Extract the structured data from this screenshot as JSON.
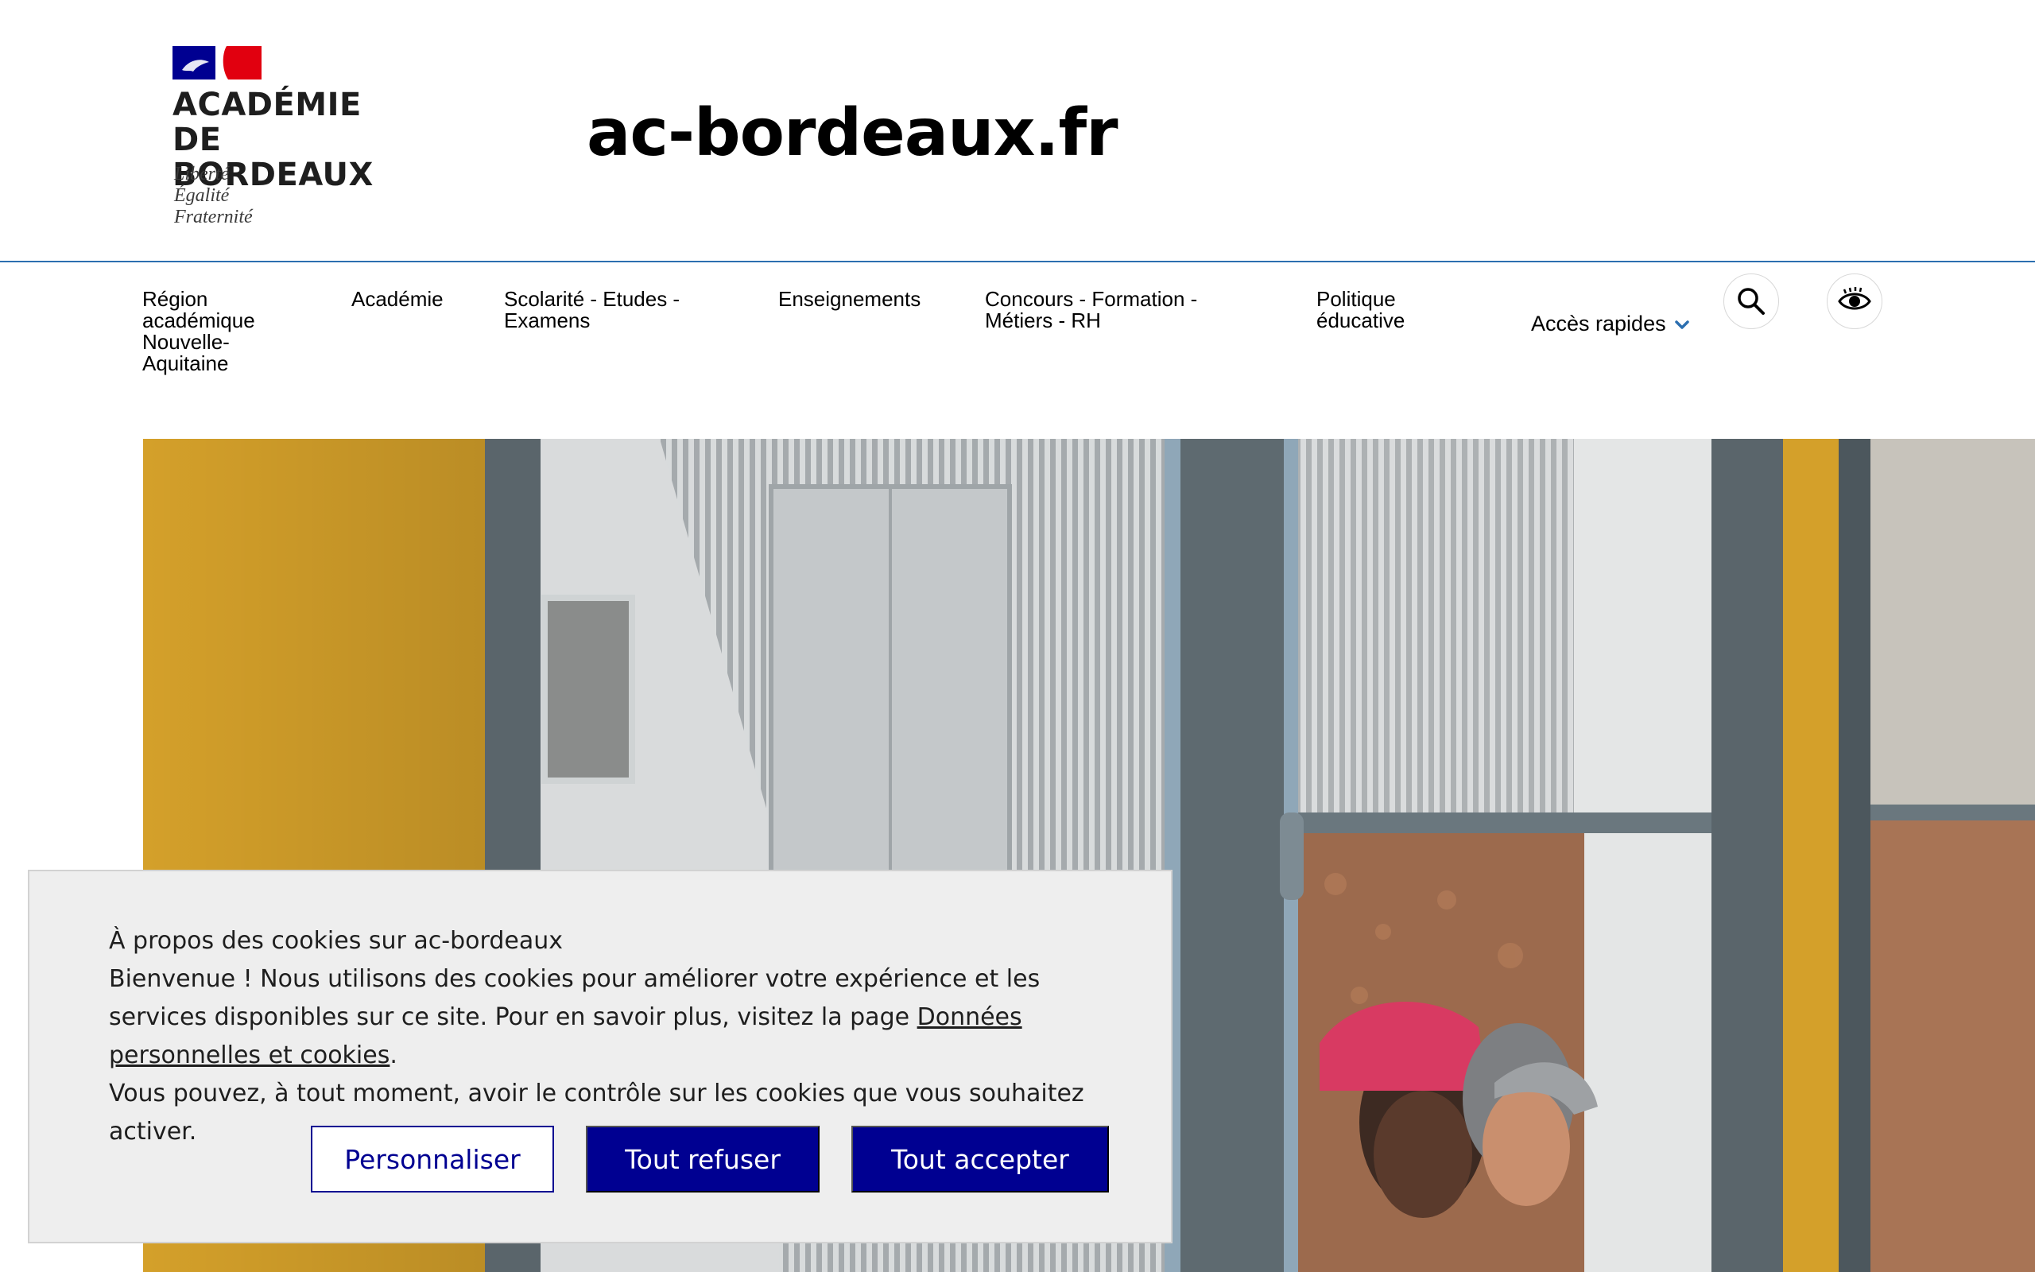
{
  "header": {
    "logo": {
      "name": "ACADÉMIE\nDE BORDEAUX",
      "motto": "Liberté\nÉgalité\nFraternité"
    },
    "site_title": "ac-bordeaux.fr"
  },
  "nav": {
    "items": [
      {
        "lines": [
          "Région",
          "académique",
          "Nouvelle-",
          "Aquitaine"
        ]
      },
      {
        "lines": [
          "Académie"
        ]
      },
      {
        "lines": [
          "Scolarité - Etudes -",
          "Examens"
        ]
      },
      {
        "lines": [
          "Enseignements"
        ]
      },
      {
        "lines": [
          "Concours - Formation -",
          "Métiers - RH"
        ]
      },
      {
        "lines": [
          "Politique",
          "éducative"
        ]
      }
    ],
    "quick_access": "Accès rapides",
    "search_icon": "search-icon",
    "accessibility_icon": "eye-icon"
  },
  "colors": {
    "brand_blue": "#000091",
    "marianne_red": "#e1000f",
    "header_rule": "#2c6fb0",
    "accent_chevron": "#2c6fb0"
  },
  "cookie_banner": {
    "title": "À propos des cookies sur ac-bordeaux",
    "body_before_link": "Bienvenue ! Nous utilisons des cookies pour améliorer votre expérience et les services disponibles sur ce site. Pour en savoir plus, visitez la page ",
    "link_text": "Données personnelles et cookies",
    "body_after_link": ".",
    "body_last": "Vous pouvez, à tout moment, avoir le contrôle sur les cookies que vous souhaitez activer.",
    "buttons": {
      "customize": "Personnaliser",
      "refuse_all": "Tout refuser",
      "accept_all": "Tout accepter"
    }
  }
}
